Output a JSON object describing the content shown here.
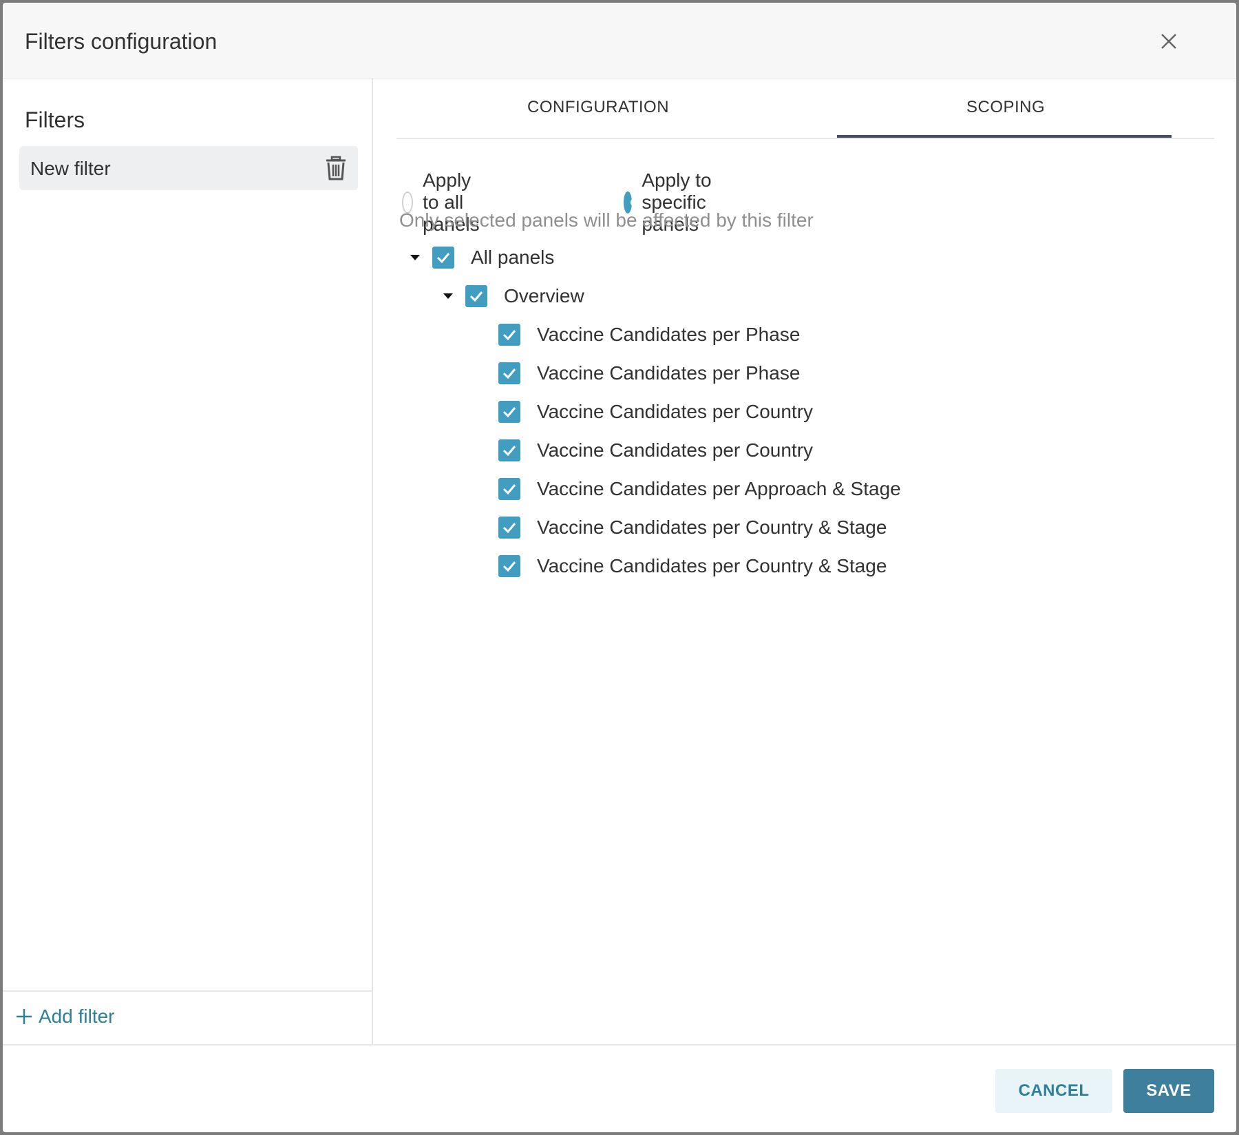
{
  "modal": {
    "title": "Filters configuration"
  },
  "left_pane": {
    "heading": "Filters",
    "filters": [
      {
        "label": "New filter"
      }
    ],
    "add_filter_label": "Add filter"
  },
  "tabs": [
    {
      "label": "CONFIGURATION",
      "active": false
    },
    {
      "label": "SCOPING",
      "active": true
    }
  ],
  "scoping": {
    "radio_options": [
      {
        "label": "Apply to all panels",
        "checked": false
      },
      {
        "label": "Apply to specific panels",
        "checked": true
      }
    ],
    "hint": "Only selected panels will be affected by this filter",
    "tree": {
      "root": {
        "label": "All panels",
        "checked": true,
        "expanded": true
      },
      "group": {
        "label": "Overview",
        "checked": true,
        "expanded": true
      },
      "panels": [
        {
          "label": "Vaccine Candidates per Phase",
          "checked": true
        },
        {
          "label": "Vaccine Candidates per Phase",
          "checked": true
        },
        {
          "label": "Vaccine Candidates per Country",
          "checked": true
        },
        {
          "label": "Vaccine Candidates per Country",
          "checked": true
        },
        {
          "label": "Vaccine Candidates per Approach & Stage",
          "checked": true
        },
        {
          "label": "Vaccine Candidates per Country & Stage",
          "checked": true
        },
        {
          "label": "Vaccine Candidates per Country & Stage",
          "checked": true
        }
      ]
    }
  },
  "footer": {
    "cancel_label": "CANCEL",
    "save_label": "SAVE"
  },
  "colors": {
    "accent": "#419ec0",
    "primary_button": "#3d7f9c",
    "tab_underline": "#484e63"
  }
}
